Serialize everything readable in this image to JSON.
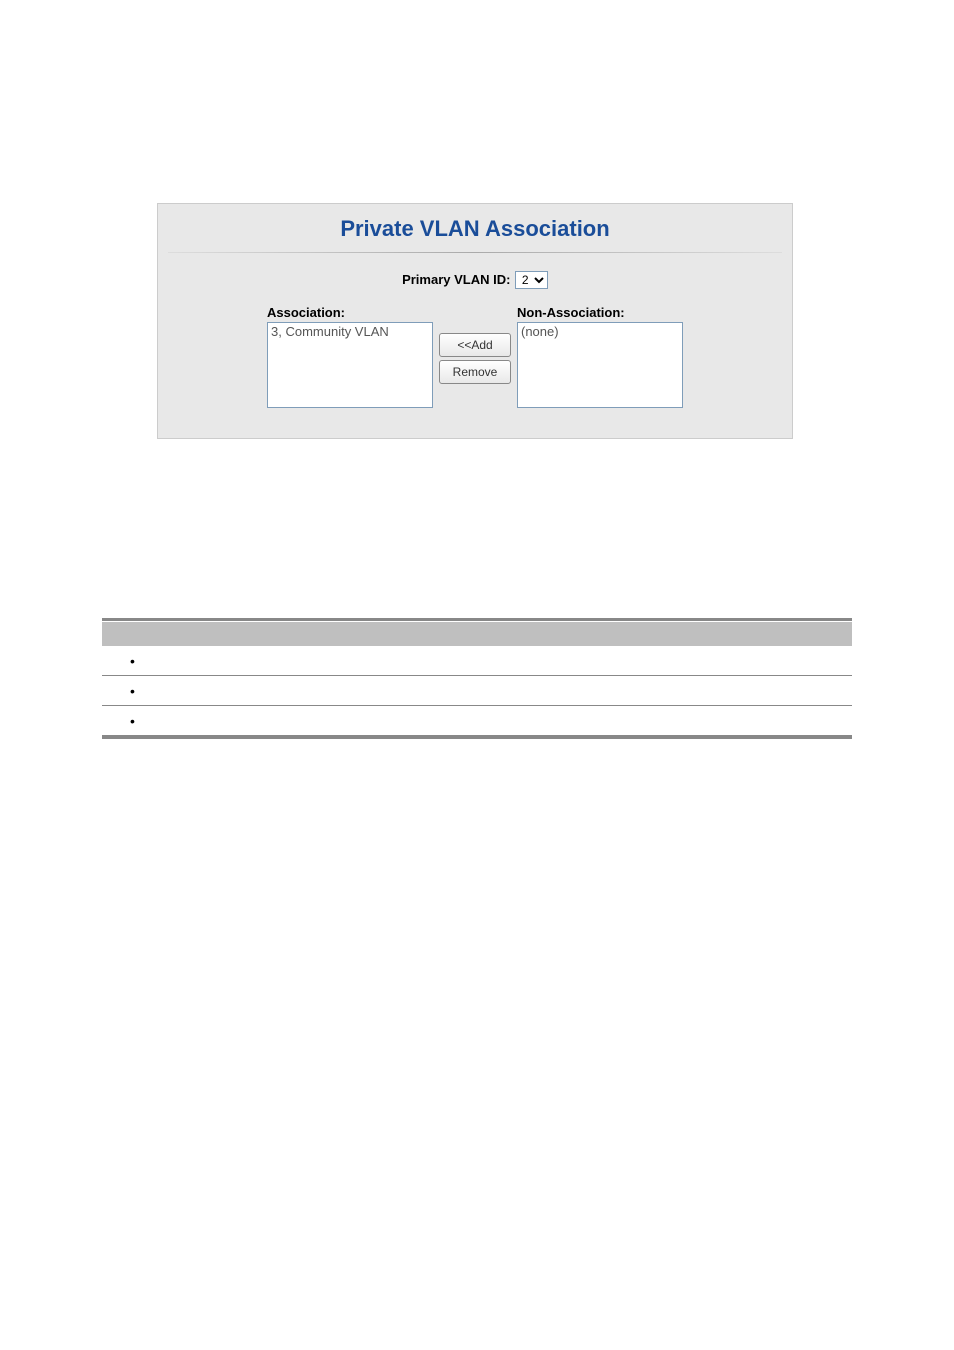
{
  "panel": {
    "title": "Private VLAN Association",
    "primaryVlanLabel": "Primary VLAN ID:",
    "primaryVlanValue": "2",
    "associationHeader": "Association:",
    "nonAssociationHeader": "Non-Association:",
    "associationItems": [
      "3, Community VLAN"
    ],
    "nonAssociationItems": [
      "(none)"
    ],
    "addButton": "<<Add",
    "removeButton": "Remove"
  }
}
